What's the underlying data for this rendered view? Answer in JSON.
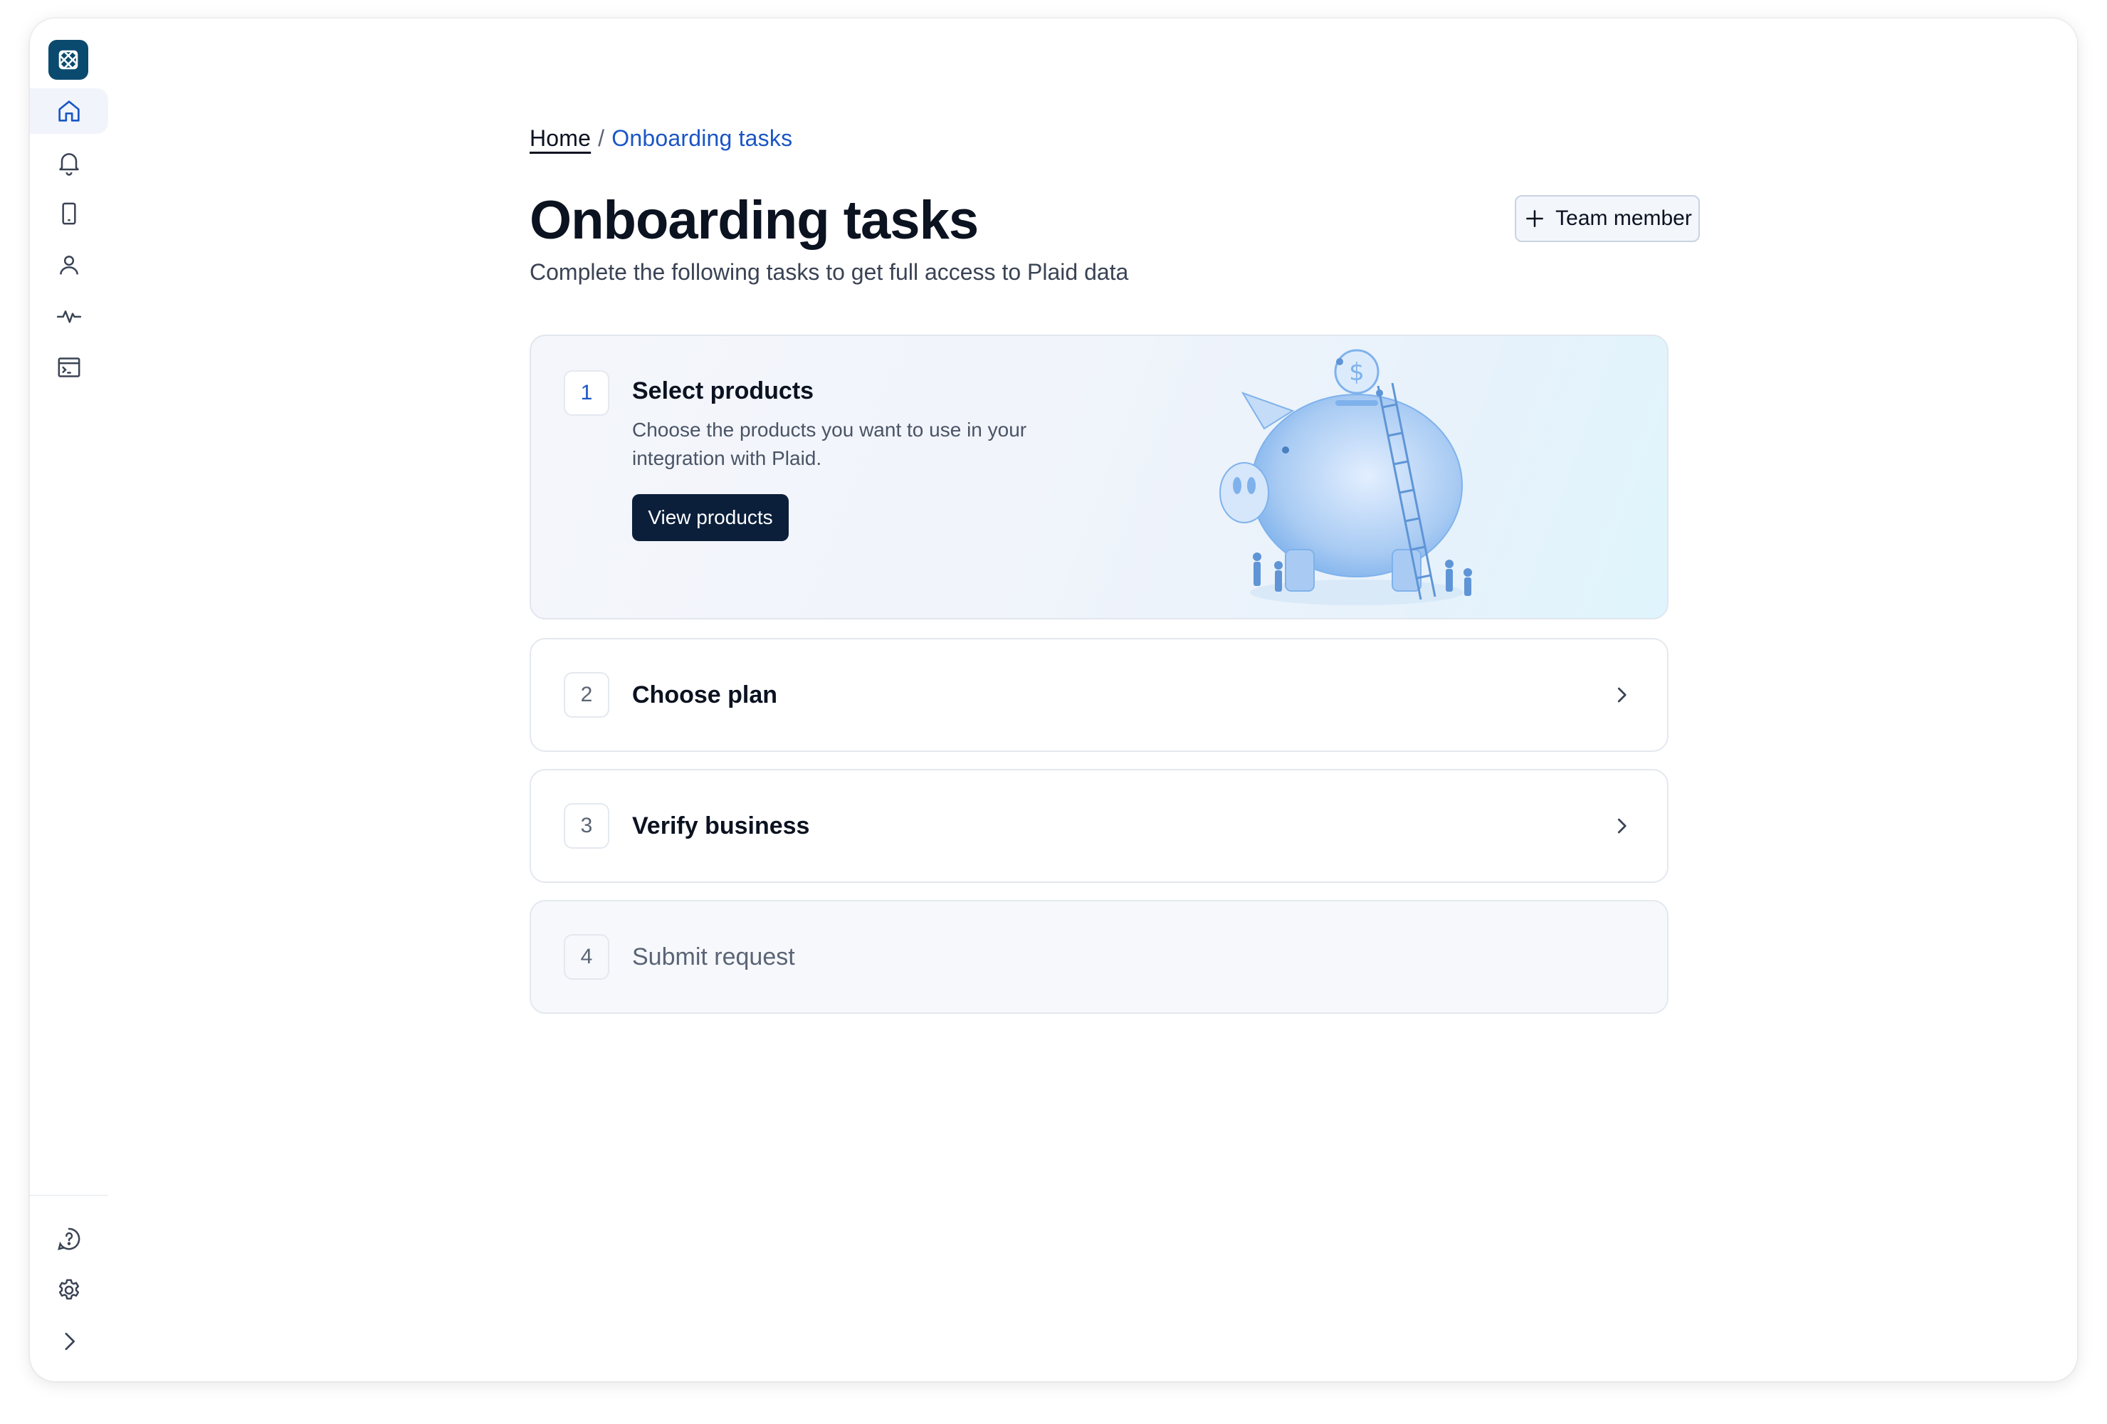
{
  "sidebar": {
    "logo": "plaid-logo-icon",
    "top_items": [
      {
        "name": "home",
        "icon": "home-icon",
        "active": true
      },
      {
        "name": "notifications",
        "icon": "bell-icon",
        "active": false
      },
      {
        "name": "device",
        "icon": "phone-icon",
        "active": false
      },
      {
        "name": "account",
        "icon": "user-icon",
        "active": false
      },
      {
        "name": "activity",
        "icon": "activity-icon",
        "active": false
      },
      {
        "name": "developer",
        "icon": "terminal-icon",
        "active": false
      }
    ],
    "bottom_items": [
      {
        "name": "help",
        "icon": "help-icon"
      },
      {
        "name": "settings",
        "icon": "gear-icon"
      },
      {
        "name": "expand",
        "icon": "chevron-right-icon"
      }
    ]
  },
  "breadcrumb": {
    "home": "Home",
    "separator": "/",
    "current": "Onboarding tasks"
  },
  "header": {
    "title": "Onboarding tasks",
    "subtitle": "Complete the following tasks to get full access to Plaid data",
    "team_button": "Team member"
  },
  "tasks": [
    {
      "number": "1",
      "title": "Select products",
      "description": "Choose the products you want to use in your integration with Plaid.",
      "button": "View products",
      "expanded": true
    },
    {
      "number": "2",
      "title": "Choose plan"
    },
    {
      "number": "3",
      "title": "Verify business"
    },
    {
      "number": "4",
      "title": "Submit request",
      "disabled": true
    }
  ],
  "colors": {
    "brand": "#0b4a6f",
    "link": "#1a56c4",
    "primary_button": "#0b1f3b",
    "border": "#e4e8ef",
    "illustration": "#7fb2ec"
  }
}
